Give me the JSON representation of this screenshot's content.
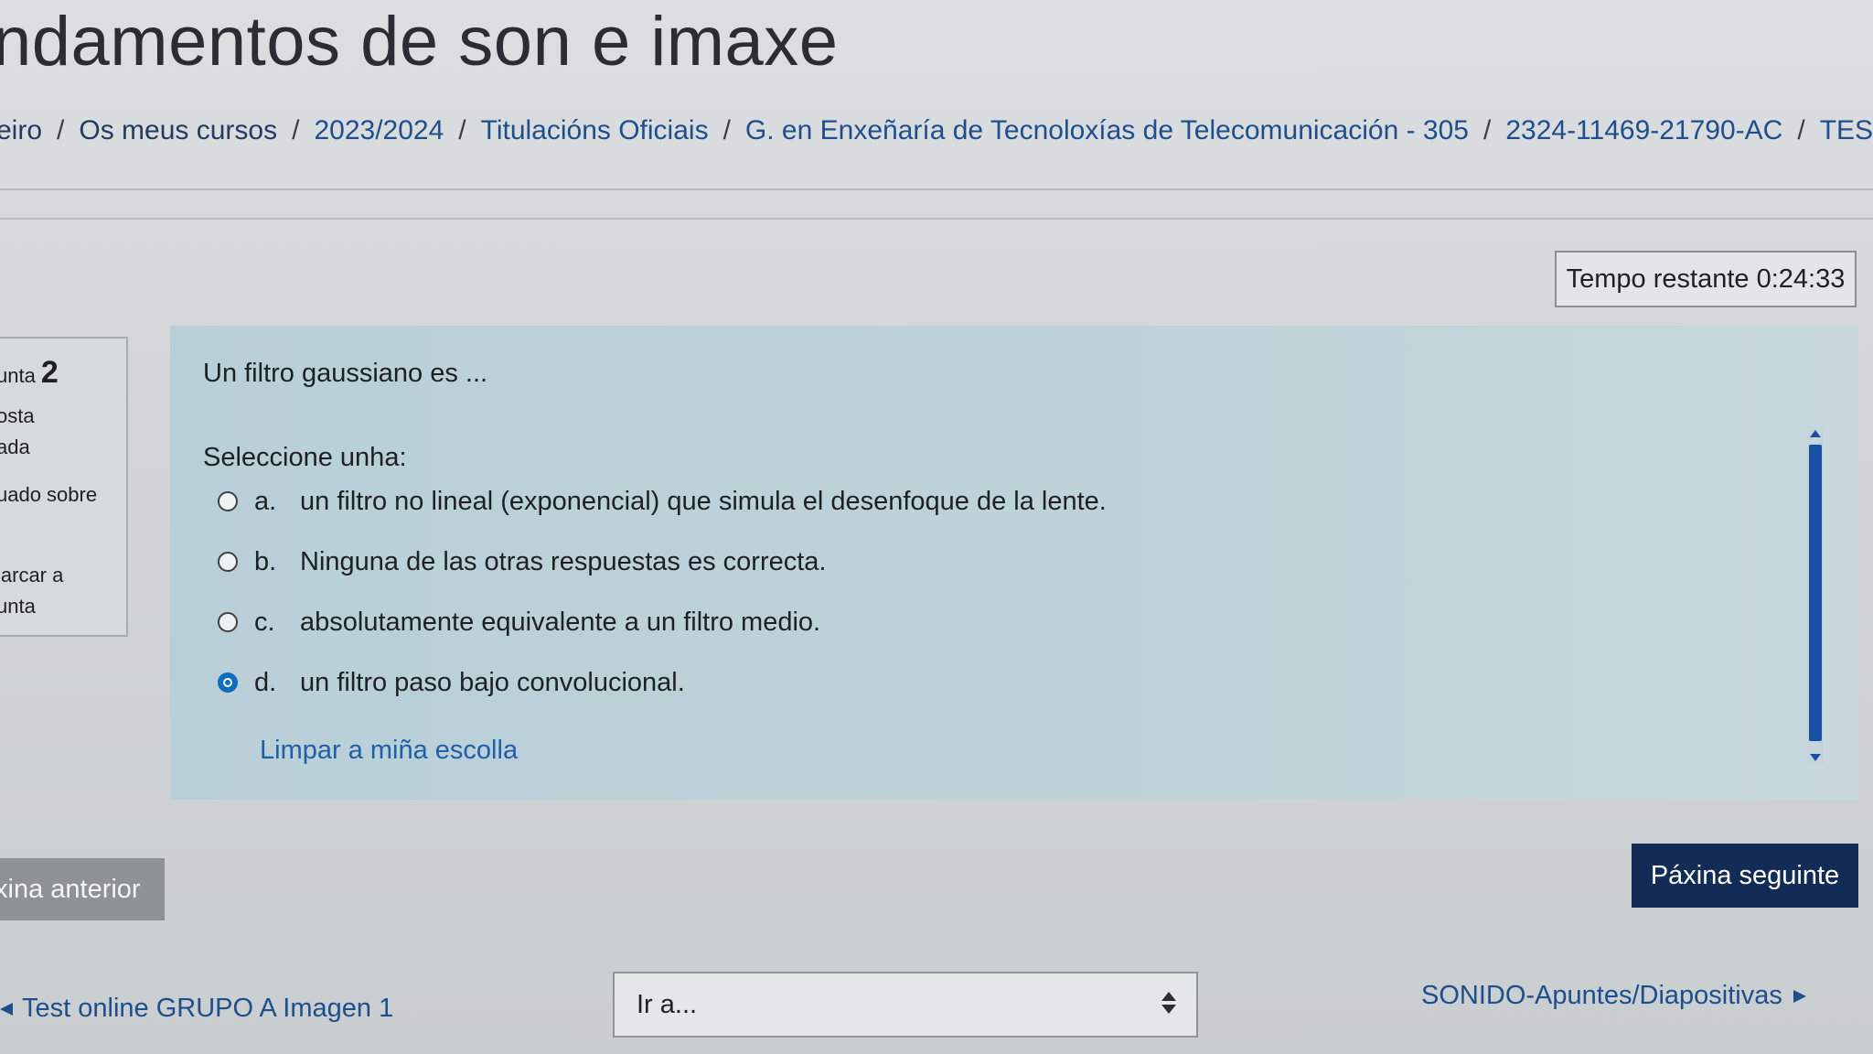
{
  "page": {
    "title": "ndamentos de son e imaxe"
  },
  "breadcrumb": {
    "items": [
      "eiro",
      "Os meus cursos",
      "2023/2024",
      "Titulacións Oficiais",
      "G. en Enxeñaría de Tecnoloxías de Telecomunicación - 305",
      "2324-11469-21790-AC",
      "TEST ONL"
    ],
    "separator": "/"
  },
  "timer": {
    "label": "Tempo restante 0:24:33"
  },
  "question_info": {
    "prefix": "unta",
    "number": "2",
    "status_line1": "osta",
    "status_line2": "ada",
    "mark_line": "uado sobre",
    "flag_line1": "larcar a",
    "flag_line2": "unta"
  },
  "question": {
    "text": "Un filtro gaussiano es ...",
    "prompt": "Seleccione unha:",
    "options": [
      {
        "letter": "a.",
        "text": "un filtro no lineal (exponencial) que simula el desenfoque de la lente.",
        "selected": false
      },
      {
        "letter": "b.",
        "text": "Ninguna de las otras respuestas es correcta.",
        "selected": false
      },
      {
        "letter": "c.",
        "text": "absolutamente equivalente a un filtro medio.",
        "selected": false
      },
      {
        "letter": "d.",
        "text": "un filtro paso bajo convolucional.",
        "selected": true
      }
    ],
    "clear_label": "Limpar a miña escolla"
  },
  "navigation": {
    "prev_page_label": "xina anterior",
    "next_page_label": "Páxina seguinte",
    "prev_activity_label": "Test online GRUPO A Imagen 1",
    "jump_select_value": "Ir a...",
    "next_activity_label": "SONIDO-Apuntes/Diapositivas"
  },
  "colors": {
    "accent": "#0f6cbf",
    "link": "#1f4e8c",
    "primary_button": "#132c57",
    "question_card": "#bfd2d9"
  }
}
